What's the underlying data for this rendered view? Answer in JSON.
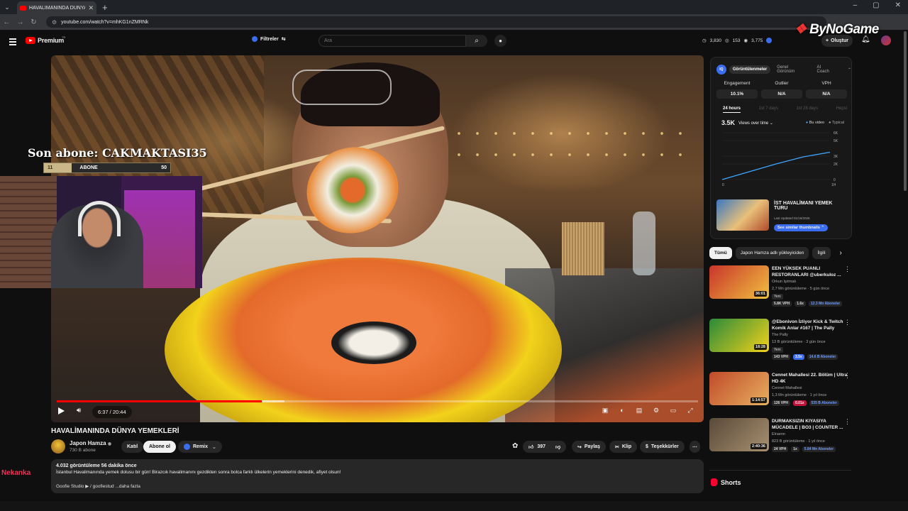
{
  "browser": {
    "tab_title": "HAVALİMANINDA DÜNYA YEME",
    "url": "youtube.com/watch?v=mhKG1nZMRNk",
    "window_controls": [
      "–",
      "▢",
      "✕"
    ]
  },
  "header": {
    "logo_text": "Premium",
    "region": "TR",
    "filters_label": "Filtreler",
    "search_placeholder": "Ara",
    "stats": [
      "3,830",
      "153",
      "3,775"
    ],
    "create_label": "Oluştur",
    "watermark": "ByNoGame"
  },
  "overlay": {
    "last_sub": "Son abone: CAKMAKTASI35",
    "goal_current": "11",
    "goal_label": "ABONE",
    "goal_target": "50",
    "goal_fraction": 0.22
  },
  "player": {
    "time": "6:37 / 20:44",
    "progress": 0.32,
    "buffered_end": 0.355
  },
  "video": {
    "title": "HAVALİMANINDA DÜNYA YEMEKLERİ",
    "channel": "Japon Hamza",
    "subs": "730 B abone",
    "join_label": "Katıl",
    "subscribe_label": "Abone ol",
    "remix_label": "Remix",
    "likes": "397",
    "share_label": "Paylaş",
    "clip_label": "Klip",
    "thanks_label": "Teşekkürler",
    "views_time": "4.032 görüntüleme  56 dakika önce",
    "description": "İstanbul Havalimanında yemek dolusu bir gün! Birazcık havalimanını gezdikten sonra bolca farklı ülkelerin yemeklerini denedik, afiyet olsun!",
    "desc_links": "Goofie Studio  ▶  / goofiestud  ...daha fazla",
    "chat_user": "Nekanka"
  },
  "extension": {
    "tabs": [
      "Görüntülenmeler",
      "Genel Görünüm",
      "AI Coach"
    ],
    "metrics": [
      {
        "label": "Engagement",
        "value": "10.1%"
      },
      {
        "label": "Outlier",
        "value": "N/A"
      },
      {
        "label": "VPH",
        "value": "N/A"
      }
    ],
    "time_tabs": [
      "24 hours",
      "1st 7 days",
      "1st 28 days",
      "Hepsi"
    ],
    "views_total": "3.5K",
    "views_dropdown": "Views over time",
    "legend_current": "Bu video",
    "legend_typical": "Typical",
    "similar_title": "İST HAVALİMANI YEMEK TURU",
    "last_updated": "Last Updated 01/16/2026",
    "similar_btn": "See similar thumbnails"
  },
  "chart_data": {
    "type": "line",
    "x_ticks": [
      "0",
      "1H"
    ],
    "y_ticks": [
      "6K",
      "5K",
      "3K",
      "2K",
      "0"
    ],
    "x": [
      0,
      0.25,
      0.5,
      0.75,
      1.0
    ],
    "series": [
      {
        "name": "Bu video",
        "values": [
          0,
          1000,
          2000,
          2900,
          3500
        ]
      }
    ],
    "ylim": [
      0,
      6000
    ],
    "grid": true,
    "legend": "top-right"
  },
  "chips": [
    "Tümü",
    "Japon Hamza adlı yükleyiciden",
    "İlgili"
  ],
  "recommendations": [
    {
      "title": "EEN YÜKSEK PUANLI RESTORANLARI @uberkuloz ...",
      "channel": "Orkun Işıtmak",
      "views": "2,7 Mn görüntüleme · 5 gün önce",
      "new": "Yeni",
      "duration": "36:01",
      "badges": [
        "5.8K VPH",
        "1.6x",
        "12.3 Mn Aboneler"
      ],
      "colors": [
        "#c9342a",
        "#f0c040"
      ]
    },
    {
      "title": "@Ebonivon İzliyor Kick & Twitch Komik Anlar #167 | The Pally",
      "channel": "The Pally",
      "views": "13 B görüntüleme · 3 gün önce",
      "new": "Yeni",
      "duration": "18:28",
      "badges": [
        "143 VPH",
        "3.5x",
        "14.6 B Aboneler"
      ],
      "colors": [
        "#2a8a3a",
        "#f2d21b"
      ]
    },
    {
      "title": "Cennet Mahallesi 22. Bölüm | Ultra HD 4K",
      "channel": "Cennet Mahallesi",
      "views": "1,3 Mn görüntüleme · 1 yıl önce",
      "new": "",
      "duration": "1:14:57",
      "badges": [
        "126 VPH",
        "0.01x",
        "535 B Aboneler"
      ],
      "colors": [
        "#c04a2a",
        "#e8b060"
      ]
    },
    {
      "title": "DURMAKSIZIN KIYASIYA MÜCADELE | BO3 | COUNTER ...",
      "channel": "Elraenn",
      "views": "823 B görüntüleme · 1 yıl önce",
      "new": "",
      "duration": "2:40:36",
      "badges": [
        "24 VPH",
        "1x",
        "5.84 Mn Aboneler"
      ],
      "colors": [
        "#5a4a3a",
        "#a89070"
      ]
    }
  ],
  "shorts_label": "Shorts"
}
